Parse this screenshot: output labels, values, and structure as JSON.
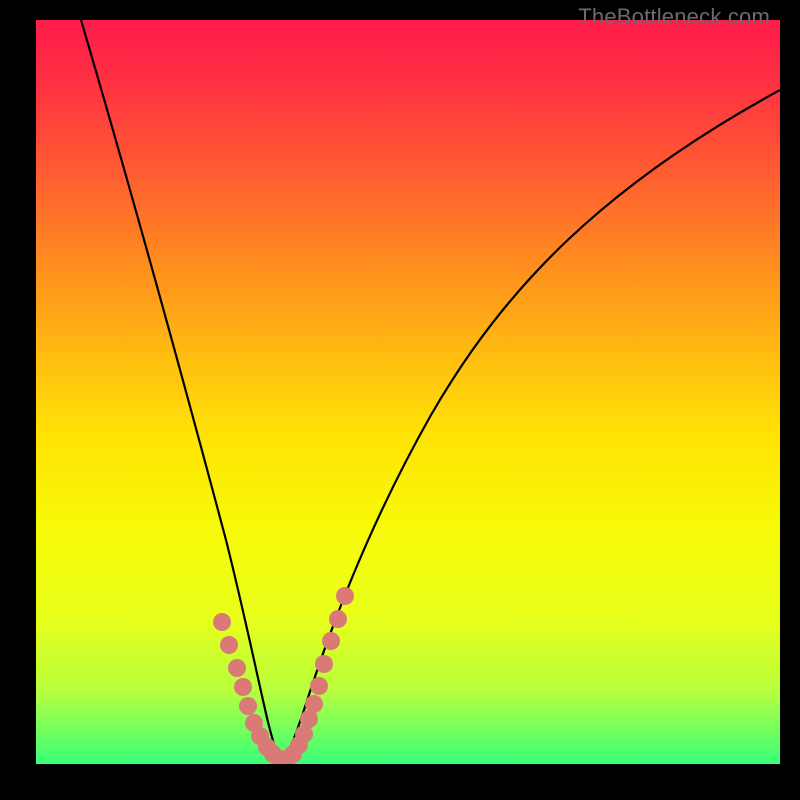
{
  "watermark": "TheBottleneck.com",
  "chart_data": {
    "type": "line",
    "title": "",
    "xlabel": "",
    "ylabel": "",
    "xlim": [
      0,
      100
    ],
    "ylim": [
      0,
      100
    ],
    "grid": false,
    "background_gradient": {
      "orientation": "vertical",
      "stops": [
        {
          "pos": 0.0,
          "color": "#ff1b4b"
        },
        {
          "pos": 0.2,
          "color": "#ff5a32"
        },
        {
          "pos": 0.44,
          "color": "#ffb812"
        },
        {
          "pos": 0.68,
          "color": "#f7fa06"
        },
        {
          "pos": 0.9,
          "color": "#b8ff3c"
        },
        {
          "pos": 1.0,
          "color": "#38ff7a"
        }
      ]
    },
    "series": [
      {
        "name": "left-branch",
        "color": "#000000",
        "x": [
          6,
          9,
          12,
          15,
          18,
          21,
          23,
          25,
          27,
          28,
          29,
          30,
          31,
          32
        ],
        "y": [
          100,
          88,
          74,
          59,
          45,
          32,
          24,
          17,
          11,
          8,
          5,
          3,
          1.5,
          0.5
        ]
      },
      {
        "name": "right-branch",
        "color": "#000000",
        "x": [
          32,
          33,
          34,
          36,
          38,
          40,
          43,
          47,
          52,
          58,
          65,
          73,
          82,
          92,
          100
        ],
        "y": [
          0.5,
          1.5,
          4,
          10,
          17,
          24,
          33,
          43,
          53,
          62,
          70,
          77,
          83,
          88,
          91
        ]
      },
      {
        "name": "valley-dots",
        "type": "scatter",
        "color": "#d97a76",
        "x": [
          24.5,
          25.5,
          26.7,
          27.5,
          28.3,
          29.0,
          29.8,
          30.7,
          31.5,
          32.3,
          33.2,
          34.0,
          34.7,
          35.3,
          36.0,
          36.7,
          37.4,
          38.1,
          38.9,
          39.7,
          40.6
        ],
        "y": [
          18.5,
          15.0,
          12.0,
          9.5,
          7.0,
          5.0,
          3.3,
          2.0,
          1.0,
          0.5,
          0.5,
          1.0,
          2.3,
          3.8,
          6.0,
          8.0,
          10.5,
          13.5,
          16.5,
          19.5,
          22.5
        ]
      }
    ]
  }
}
